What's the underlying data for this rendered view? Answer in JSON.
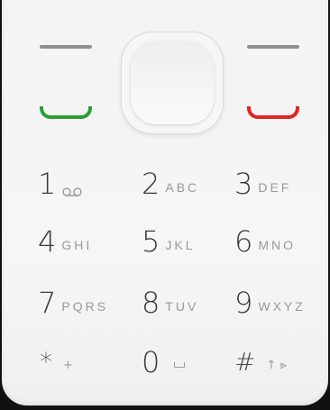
{
  "keypad": {
    "keys": [
      {
        "digit": "1",
        "letters": ""
      },
      {
        "digit": "2",
        "letters": "ABC"
      },
      {
        "digit": "3",
        "letters": "DEF"
      },
      {
        "digit": "4",
        "letters": "GHI"
      },
      {
        "digit": "5",
        "letters": "JKL"
      },
      {
        "digit": "6",
        "letters": "MNO"
      },
      {
        "digit": "7",
        "letters": "PQRS"
      },
      {
        "digit": "8",
        "letters": "TUV"
      },
      {
        "digit": "9",
        "letters": "WXYZ"
      },
      {
        "digit": "0",
        "letters": ""
      }
    ],
    "star": {
      "symbol": "*",
      "sub": "+"
    },
    "hash": {
      "symbol": "#",
      "sub": "↑ ⪢"
    }
  },
  "icons": {
    "voicemail": "voicemail-icon",
    "space": "space-icon",
    "call": "call-icon",
    "end": "end-call-icon"
  },
  "colors": {
    "call": "#2e9c35",
    "end": "#e12424",
    "body": "#f4f4f4"
  }
}
